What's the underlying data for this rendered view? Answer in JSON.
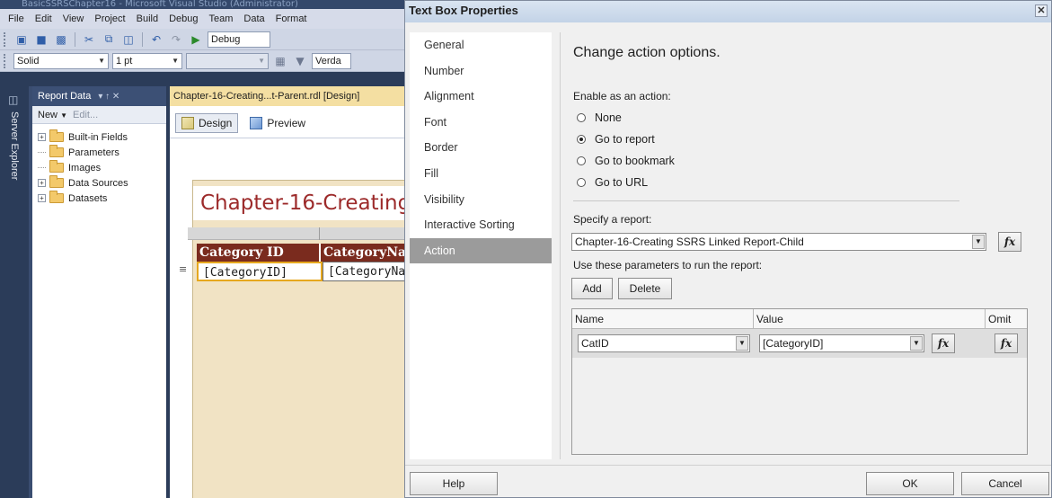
{
  "vs": {
    "title": "BasicSSRSChapter16 - Microsoft Visual Studio (Administrator)",
    "menu": [
      "File",
      "Edit",
      "View",
      "Project",
      "Build",
      "Debug",
      "Team",
      "Data",
      "Format"
    ],
    "toolbar1": {
      "config": "Debug"
    },
    "toolbar2": {
      "border_style": "Solid",
      "border_width": "1 pt",
      "font": "Verda"
    },
    "server_explorer_label": "Server Explorer",
    "report_data": {
      "title": "Report Data",
      "pin": "▾ ↑ ✕",
      "new_label": "New",
      "edit_label": "Edit...",
      "items": [
        {
          "label": "Built-in Fields",
          "expander": "+"
        },
        {
          "label": "Parameters",
          "expander": ""
        },
        {
          "label": "Images",
          "expander": ""
        },
        {
          "label": "Data Sources",
          "expander": "+"
        },
        {
          "label": "Datasets",
          "expander": "+"
        }
      ]
    },
    "document": {
      "tab_title": "Chapter-16-Creating...t-Parent.rdl [Design]",
      "design_tab": "Design",
      "preview_tab": "Preview",
      "report_title": "Chapter-16-Creating",
      "columns": [
        "Category ID",
        "CategoryName"
      ],
      "cells": [
        "[CategoryID]",
        "[CategoryName]"
      ],
      "row_glyph": "≡"
    }
  },
  "dialog": {
    "title": "Text Box Properties",
    "close": "✕",
    "nav": [
      "General",
      "Number",
      "Alignment",
      "Font",
      "Border",
      "Fill",
      "Visibility",
      "Interactive Sorting",
      "Action"
    ],
    "active_nav": "Action",
    "heading": "Change action options.",
    "enable_label": "Enable as an action:",
    "radios": [
      {
        "label": "None",
        "selected": false
      },
      {
        "label": "Go to report",
        "selected": true
      },
      {
        "label": "Go to bookmark",
        "selected": false
      },
      {
        "label": "Go to URL",
        "selected": false
      }
    ],
    "specify_label": "Specify a report:",
    "report_value": "Chapter-16-Creating SSRS Linked Report-Child",
    "params_label": "Use these parameters to run the report:",
    "add_label": "Add",
    "delete_label": "Delete",
    "grid": {
      "headers": {
        "name": "Name",
        "value": "Value",
        "omit": "Omit"
      },
      "rows": [
        {
          "name": "CatID",
          "value": "[CategoryID]"
        }
      ]
    },
    "fx": "fx",
    "help_label": "Help",
    "ok_label": "OK",
    "cancel_label": "Cancel"
  }
}
